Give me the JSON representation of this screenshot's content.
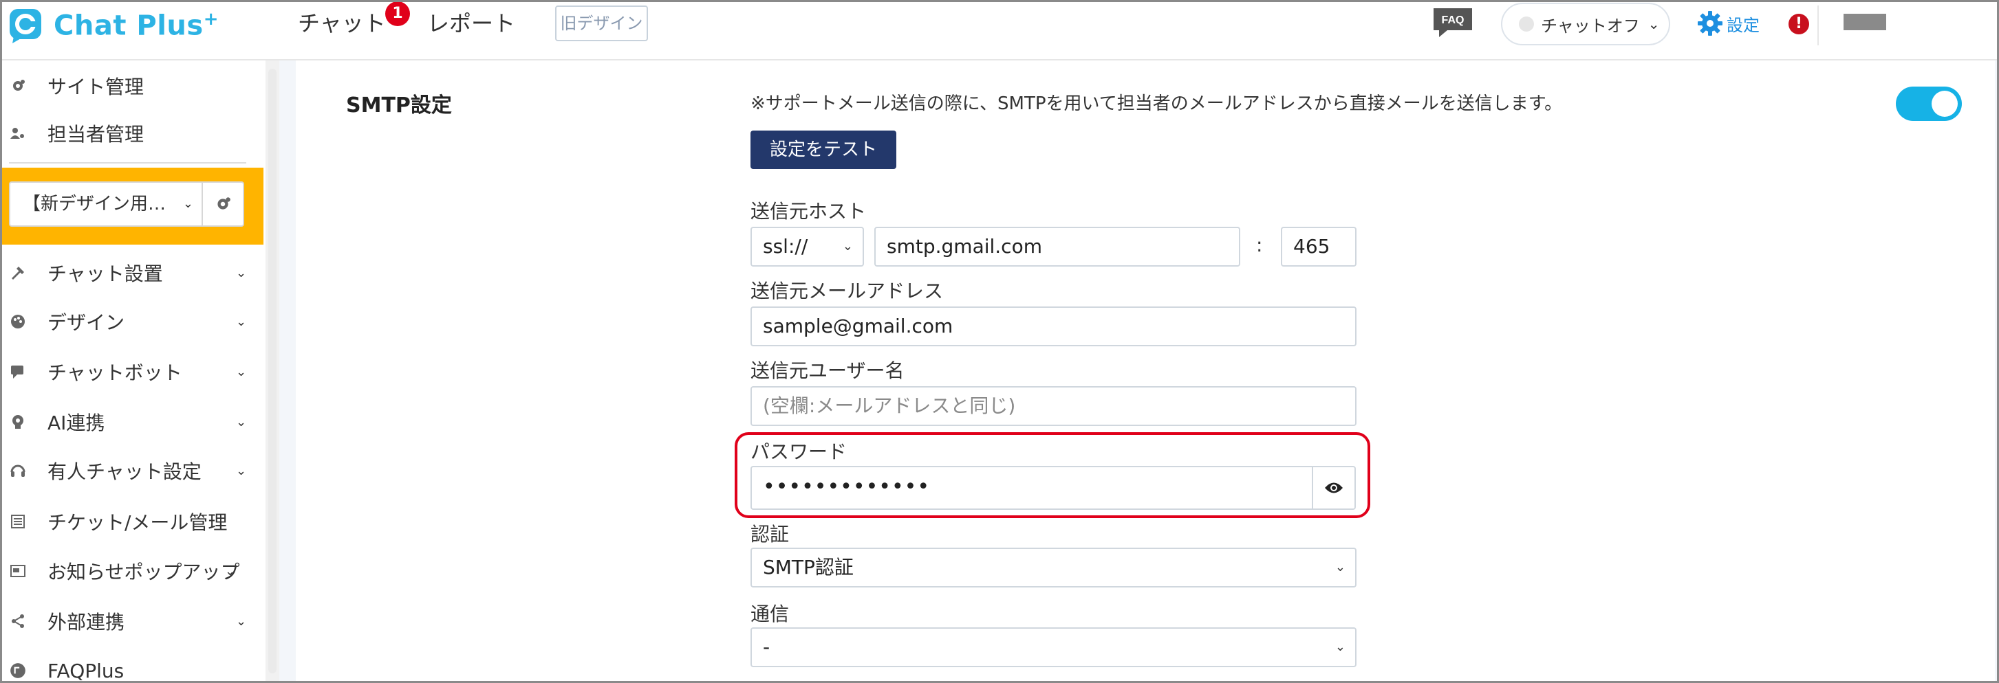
{
  "header": {
    "logo_text": "Chat Plus",
    "logo_plus": "+",
    "nav": [
      {
        "label": "チャット",
        "badge": "1"
      },
      {
        "label": "レポート"
      }
    ],
    "old_design_label": "旧デザイン",
    "faq_label": "FAQ",
    "chat_status": "チャットオフ",
    "settings_label": "設定",
    "alert_glyph": "!"
  },
  "sidebar": {
    "items_top": [
      {
        "label": "サイト管理",
        "icon": "gear-icon"
      },
      {
        "label": "担当者管理",
        "icon": "users-icon"
      }
    ],
    "site_select": "【新デザイン用…",
    "items": [
      {
        "label": "チャット設置",
        "icon": "tools-icon",
        "expandable": true
      },
      {
        "label": "デザイン",
        "icon": "palette-icon",
        "expandable": true
      },
      {
        "label": "チャットボット",
        "icon": "chat-bubble-icon",
        "expandable": true
      },
      {
        "label": "AI連携",
        "icon": "ai-bulb-icon",
        "expandable": true
      },
      {
        "label": "有人チャット設定",
        "icon": "headset-icon",
        "expandable": true
      },
      {
        "label": "チケット/メール管理",
        "icon": "ticket-icon",
        "expandable": false
      },
      {
        "label": "お知らせポップアップ",
        "icon": "popup-icon",
        "expandable": true
      },
      {
        "label": "外部連携",
        "icon": "share-icon",
        "expandable": true
      },
      {
        "label": "FAQPlus",
        "icon": "faq-plus-icon",
        "expandable": false
      }
    ]
  },
  "smtp": {
    "title": "SMTP設定",
    "description": "※サポートメール送信の際に、SMTPを用いて担当者のメールアドレスから直接メールを送信します。",
    "enabled": true,
    "test_button": "設定をテスト",
    "host_label": "送信元ホスト",
    "protocol": "ssl://",
    "host": "smtp.gmail.com",
    "port_separator": ":",
    "port": "465",
    "email_label": "送信元メールアドレス",
    "email": "sample@gmail.com",
    "username_label": "送信元ユーザー名",
    "username_placeholder": "(空欄:メールアドレスと同じ)",
    "password_label": "パスワード",
    "password_masked": "•••••••••••••",
    "auth_label": "認証",
    "auth": "SMTP認証",
    "comm_label": "通信",
    "comm": "-"
  },
  "colors": {
    "brand": "#2db3e4",
    "sidebar_highlight": "#ffb400",
    "test_button": "#23386b",
    "toggle_on": "#16b2e6",
    "annotation_red": "#e0001a"
  }
}
